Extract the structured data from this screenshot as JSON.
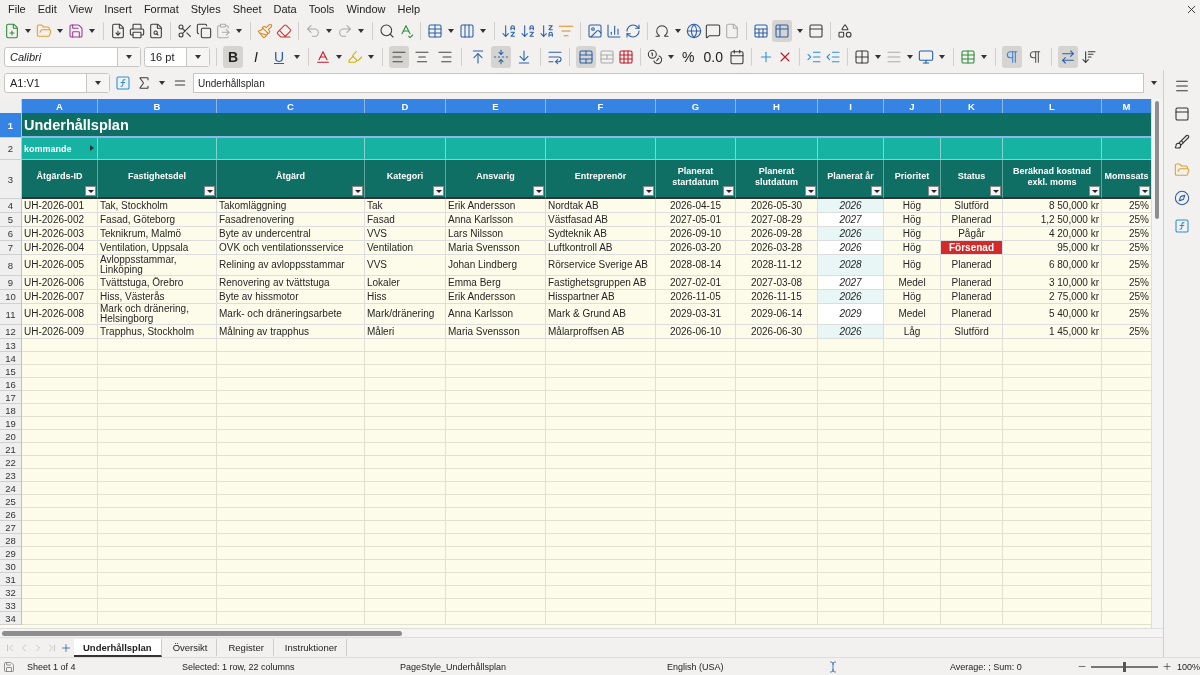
{
  "menu": [
    "File",
    "Edit",
    "View",
    "Insert",
    "Format",
    "Styles",
    "Sheet",
    "Data",
    "Tools",
    "Window",
    "Help"
  ],
  "standard_toolbar": {
    "freeze_on": true
  },
  "format_toolbar": {
    "font_name": "Calibri",
    "font_size": "16 pt",
    "bold": {
      "label": "B",
      "on": true
    },
    "italic": {
      "label": "I",
      "on": false
    },
    "underline": {
      "label": "U",
      "on": false
    },
    "align_left_on": true,
    "align_center_on": false,
    "align_right_on": false,
    "align_top_on": false,
    "align_middle_on": true,
    "align_bottom_on": false,
    "merge_on": true,
    "percent": "%",
    "number_format": "0.0",
    "ltr_on": true,
    "rtl_on": false,
    "text_direction_on": true
  },
  "formula_bar": {
    "name_box": "A1:V1",
    "content": "Underhållsplan"
  },
  "sheet": {
    "columns": [
      {
        "letter": "A",
        "selected": true
      },
      {
        "letter": "B",
        "selected": true
      },
      {
        "letter": "C",
        "selected": true
      },
      {
        "letter": "D",
        "selected": true
      },
      {
        "letter": "E",
        "selected": true
      },
      {
        "letter": "F",
        "selected": true
      },
      {
        "letter": "G",
        "selected": true
      },
      {
        "letter": "H",
        "selected": true
      },
      {
        "letter": "I",
        "selected": true
      },
      {
        "letter": "J",
        "selected": true
      },
      {
        "letter": "K",
        "selected": true
      },
      {
        "letter": "L",
        "selected": true
      },
      {
        "letter": "M",
        "selected": true
      }
    ],
    "row_numbers": [
      {
        "label": "1",
        "selected": true
      },
      {
        "label": "2",
        "selected": false
      },
      {
        "label": "3",
        "selected": false
      },
      {
        "label": "4",
        "selected": false
      },
      {
        "label": "5",
        "selected": false
      },
      {
        "label": "6",
        "selected": false
      },
      {
        "label": "7",
        "selected": false
      },
      {
        "label": "8",
        "selected": false
      },
      {
        "label": "9",
        "selected": false
      },
      {
        "label": "10",
        "selected": false
      },
      {
        "label": "11",
        "selected": false
      },
      {
        "label": "12",
        "selected": false
      },
      {
        "label": "13",
        "selected": false
      },
      {
        "label": "14",
        "selected": false
      },
      {
        "label": "15",
        "selected": false
      },
      {
        "label": "16",
        "selected": false
      },
      {
        "label": "17",
        "selected": false
      },
      {
        "label": "18",
        "selected": false
      },
      {
        "label": "19",
        "selected": false
      },
      {
        "label": "20",
        "selected": false
      },
      {
        "label": "21",
        "selected": false
      },
      {
        "label": "22",
        "selected": false
      },
      {
        "label": "23",
        "selected": false
      },
      {
        "label": "24",
        "selected": false
      },
      {
        "label": "25",
        "selected": false
      },
      {
        "label": "26",
        "selected": false
      },
      {
        "label": "27",
        "selected": false
      },
      {
        "label": "28",
        "selected": false
      },
      {
        "label": "29",
        "selected": false
      },
      {
        "label": "30",
        "selected": false
      },
      {
        "label": "31",
        "selected": false
      },
      {
        "label": "32",
        "selected": false
      },
      {
        "label": "33",
        "selected": false
      },
      {
        "label": "34",
        "selected": false
      }
    ],
    "title": "Underhållsplan",
    "subtitle": "kommande",
    "headings": [
      "Åtgärds-ID",
      "Fastighetsdel",
      "Åtgärd",
      "Kategori",
      "Ansvarig",
      "Entreprenör",
      "Planerat startdatum",
      "Planerat slutdatum",
      "Planerat år",
      "Prioritet",
      "Status",
      "Beräknad kostnad exkl. moms",
      "Momssats"
    ],
    "rows": [
      {
        "cells": [
          "UH-2026-001",
          "Tak, Stockholm",
          "Takomläggning",
          "Tak",
          "Erik Andersson",
          "Nordtak AB",
          "2026-04-15",
          "2026-05-30",
          "2026",
          "Hög",
          "Slutförd",
          "8 50,000 kr",
          "25%"
        ],
        "overdue": false
      },
      {
        "cells": [
          "UH-2026-002",
          "Fasad, Göteborg",
          "Fasadrenovering",
          "Fasad",
          "Anna Karlsson",
          "Västfasad AB",
          "2027-05-01",
          "2027-08-29",
          "2027",
          "Hög",
          "Planerad",
          "1,2 50,000 kr",
          "25%"
        ],
        "overdue": false
      },
      {
        "cells": [
          "UH-2026-003",
          "Teknikrum, Malmö",
          "Byte av undercentral",
          "VVS",
          "Lars Nilsson",
          "Sydteknik AB",
          "2026-09-10",
          "2026-09-28",
          "2026",
          "Hög",
          "Pågår",
          "4 20,000 kr",
          "25%"
        ],
        "overdue": false
      },
      {
        "cells": [
          "UH-2026-004",
          "Ventilation, Uppsala",
          "OVK och ventilationsservice",
          "Ventilation",
          "Maria Svensson",
          "Luftkontroll AB",
          "2026-03-20",
          "2026-03-28",
          "2026",
          "Hög",
          "Försenad",
          "95,000 kr",
          "25%"
        ],
        "overdue": true
      },
      {
        "cells": [
          "UH-2026-005",
          "Avloppsstammar, Linköping",
          "Relining av avloppsstammar",
          "VVS",
          "Johan Lindberg",
          "Rörservice Sverige AB",
          "2028-08-14",
          "2028-11-12",
          "2028",
          "Hög",
          "Planerad",
          "6 80,000 kr",
          "25%"
        ],
        "overdue": false
      },
      {
        "cells": [
          "UH-2026-006",
          "Tvättstuga, Örebro",
          "Renovering av tvättstuga",
          "Lokaler",
          "Emma Berg",
          "Fastighetsgruppen AB",
          "2027-02-01",
          "2027-03-08",
          "2027",
          "Medel",
          "Planerad",
          "3 10,000 kr",
          "25%"
        ],
        "overdue": false
      },
      {
        "cells": [
          "UH-2026-007",
          "Hiss, Västerås",
          "Byte av hissmotor",
          "Hiss",
          "Erik Andersson",
          "Hisspartner AB",
          "2026-11-05",
          "2026-11-15",
          "2026",
          "Hög",
          "Planerad",
          "2 75,000 kr",
          "25%"
        ],
        "overdue": false
      },
      {
        "cells": [
          "UH-2026-008",
          "Mark och dränering, Helsingborg",
          "Mark- och dräneringsarbete",
          "Mark/dränering",
          "Anna Karlsson",
          "Mark & Grund AB",
          "2029-03-31",
          "2029-06-14",
          "2029",
          "Medel",
          "Planerad",
          "5 40,000 kr",
          "25%"
        ],
        "overdue": false
      },
      {
        "cells": [
          "UH-2026-009",
          "Trapphus, Stockholm",
          "Målning av trapphus",
          "Måleri",
          "Maria Svensson",
          "Målarproffsen AB",
          "2026-06-10",
          "2026-06-30",
          "2026",
          "Låg",
          "Slutförd",
          "1 45,000 kr",
          "25%"
        ],
        "overdue": false
      }
    ]
  },
  "sheet_tabs": [
    {
      "label": "Underhållsplan",
      "selected": true
    },
    {
      "label": "Översikt",
      "selected": false
    },
    {
      "label": "Register",
      "selected": false
    },
    {
      "label": "Instruktioner",
      "selected": false
    }
  ],
  "status_bar": {
    "sheet": "Sheet 1 of 4",
    "selection": "Selected: 1 row, 22 columns",
    "page_style": "PageStyle_Underhållsplan",
    "language": "English (USA)",
    "summary": "Average: ; Sum: 0",
    "zoom": {
      "level": 0.5,
      "reading": "100%"
    }
  }
}
